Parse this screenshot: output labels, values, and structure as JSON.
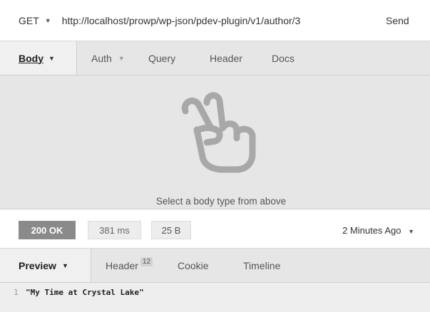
{
  "request": {
    "method": "GET",
    "url": "http://localhost/prowp/wp-json/pdev-plugin/v1/author/3",
    "send_label": "Send"
  },
  "request_tabs": {
    "body": "Body",
    "auth": "Auth",
    "query": "Query",
    "header": "Header",
    "docs": "Docs"
  },
  "body_pane": {
    "icon": "peace-hand-icon",
    "hint": "Select a body type from above"
  },
  "status": {
    "code": "200 OK",
    "time": "381 ms",
    "size": "25 B",
    "ago": "2 Minutes Ago"
  },
  "response_tabs": {
    "preview": "Preview",
    "header": "Header",
    "header_count": "12",
    "cookie": "Cookie",
    "timeline": "Timeline"
  },
  "preview": {
    "line_number": "1",
    "content": "\"My Time at Crystal Lake\""
  }
}
